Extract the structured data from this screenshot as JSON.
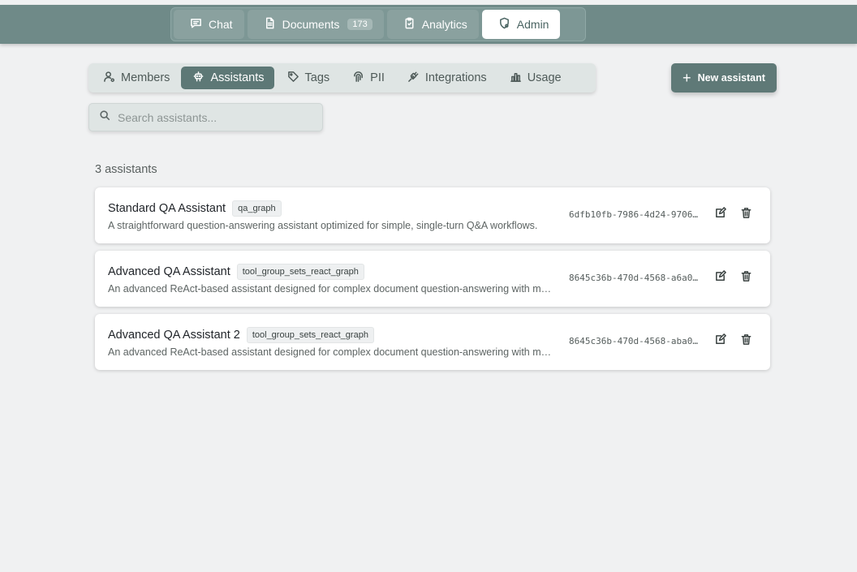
{
  "topnav": {
    "items": [
      {
        "label": "Chat",
        "icon": "chat-icon"
      },
      {
        "label": "Documents",
        "icon": "document-icon",
        "badge": "173"
      },
      {
        "label": "Analytics",
        "icon": "clipboard-icon"
      },
      {
        "label": "Admin",
        "icon": "shield-gear-icon",
        "active": true
      }
    ]
  },
  "tabs": {
    "items": [
      {
        "label": "Members",
        "icon": "user-icon"
      },
      {
        "label": "Assistants",
        "icon": "robot-icon",
        "active": true
      },
      {
        "label": "Tags",
        "icon": "tag-icon"
      },
      {
        "label": "PII",
        "icon": "fingerprint-icon"
      },
      {
        "label": "Integrations",
        "icon": "plug-icon"
      },
      {
        "label": "Usage",
        "icon": "bar-chart-icon"
      }
    ]
  },
  "actions": {
    "new_assistant_label": "New assistant"
  },
  "search": {
    "placeholder": "Search assistants...",
    "value": ""
  },
  "list": {
    "count_label": "3 assistants",
    "assistants": [
      {
        "name": "Standard QA Assistant",
        "graph": "qa_graph",
        "description": "A straightforward question-answering assistant optimized for simple, single-turn Q&A workflows.",
        "id": "6dfb10fb-7986-4d24-9706…"
      },
      {
        "name": "Advanced QA Assistant",
        "graph": "tool_group_sets_react_graph",
        "description": "An advanced ReAct-based assistant designed for complex document question-answering with multi-step reasoning.",
        "id": "8645c36b-470d-4568-a6a0…"
      },
      {
        "name": "Advanced QA Assistant 2",
        "graph": "tool_group_sets_react_graph",
        "description": "An advanced ReAct-based assistant designed for complex document question-answering with multi-step reasoning.",
        "id": "8645c36b-470d-4568-aba0…"
      }
    ]
  },
  "colors": {
    "header": "#6f8a88",
    "accent": "#5f7977",
    "background": "#f0f1f2"
  }
}
